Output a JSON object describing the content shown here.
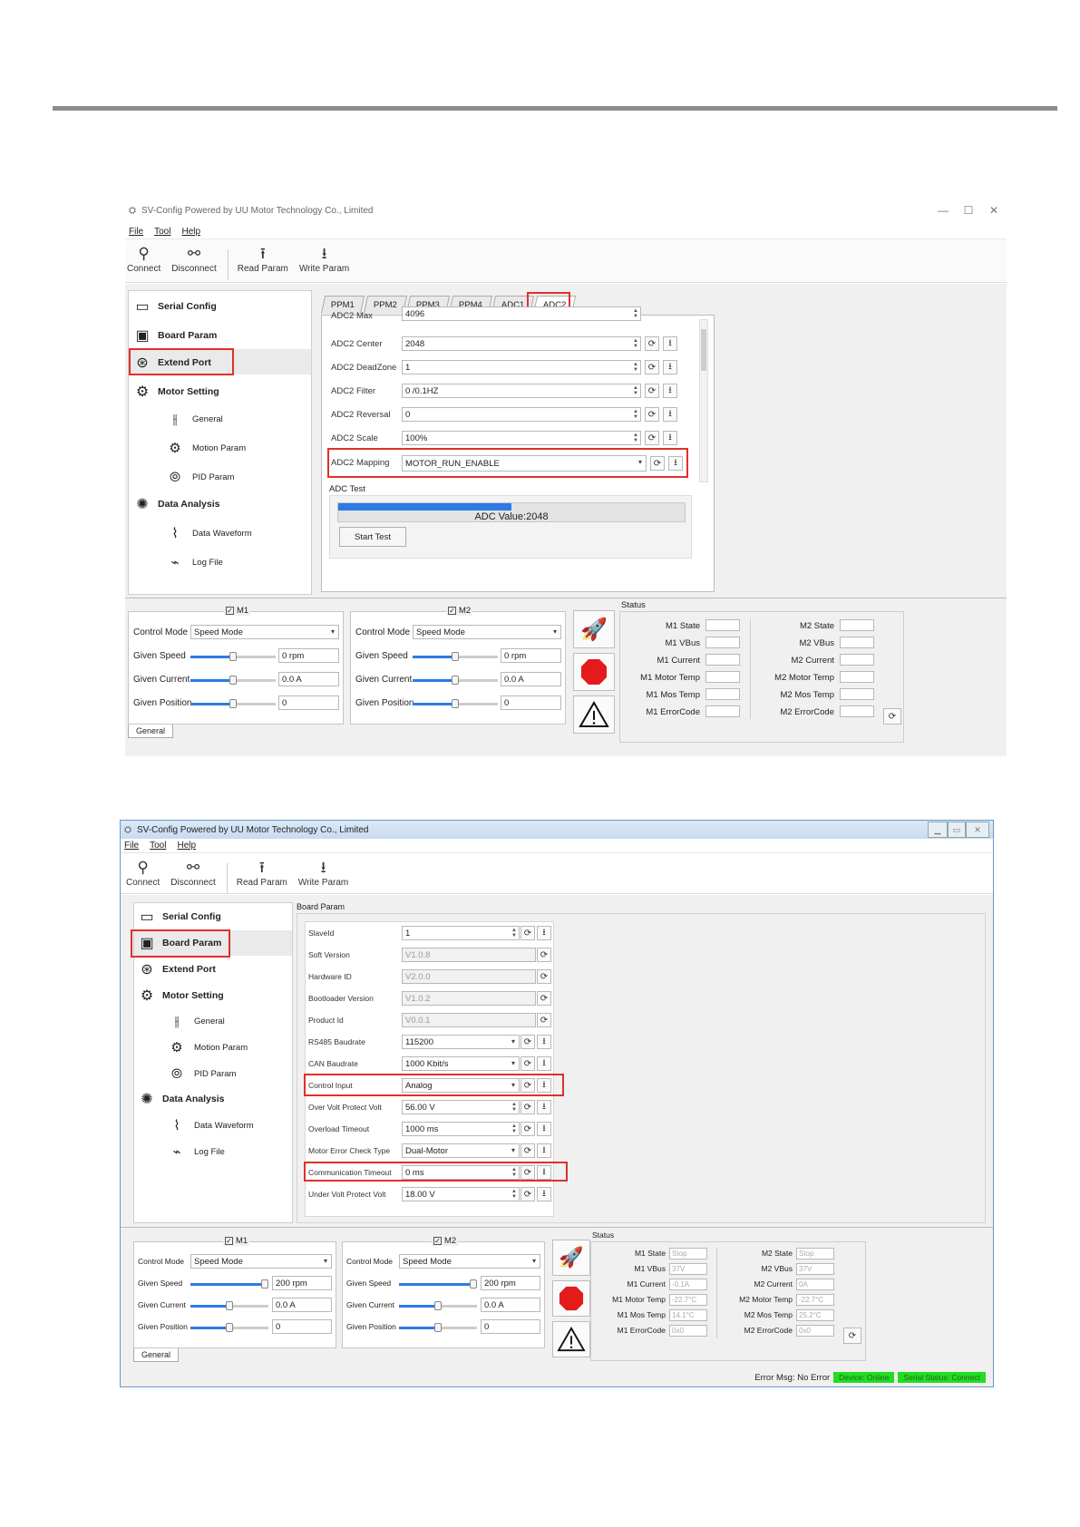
{
  "win1": {
    "title": "SV-Config Powered by UU Motor Technology Co., Limited",
    "menu": [
      "File",
      "Tool",
      "Help"
    ],
    "toolbar": [
      {
        "label": "Connect",
        "icon": "connect-icon"
      },
      {
        "label": "Disconnect",
        "icon": "disconnect-icon"
      },
      {
        "label": "Read Param",
        "icon": "upload-icon"
      },
      {
        "label": "Write Param",
        "icon": "download-icon"
      }
    ],
    "nav": {
      "serial_config": "Serial Config",
      "board_param": "Board Param",
      "extend_port": "Extend Port",
      "motor_setting": "Motor Setting",
      "general": "General",
      "motion_param": "Motion Param",
      "pid_param": "PID Param",
      "data_analysis": "Data Analysis",
      "data_waveform": "Data Waveform",
      "log_file": "Log File"
    },
    "tabs": [
      "PPM1",
      "PPM2",
      "PPM3",
      "PPM4",
      "ADC1",
      "ADC2"
    ],
    "selected_tab": "ADC2",
    "params": [
      {
        "label": "ADC2 Max",
        "value": "4096"
      },
      {
        "label": "ADC2 Center",
        "value": "2048"
      },
      {
        "label": "ADC2 DeadZone",
        "value": "1"
      },
      {
        "label": "ADC2 Filter",
        "value": "0 /0.1HZ"
      },
      {
        "label": "ADC2 Reversal",
        "value": "0"
      },
      {
        "label": "ADC2 Scale",
        "value": "100%"
      },
      {
        "label": "ADC2 Mapping",
        "value": "MOTOR_RUN_ENABLE"
      }
    ],
    "adc_test": {
      "title": "ADC Test",
      "value_text": "ADC Value:2048",
      "progress": 0.5,
      "start_label": "Start Test"
    },
    "m1": {
      "label": "M1",
      "control_mode_label": "Control Mode",
      "control_mode": "Speed Mode",
      "given_speed_label": "Given Speed",
      "given_speed": "0 rpm",
      "given_current_label": "Given Current",
      "given_current": "0.0 A",
      "given_position_label": "Given Position",
      "given_position": "0"
    },
    "m2": {
      "label": "M2",
      "control_mode_label": "Control Mode",
      "control_mode": "Speed Mode",
      "given_speed_label": "Given Speed",
      "given_speed": "0 rpm",
      "given_current_label": "Given Current",
      "given_current": "0.0 A",
      "given_position_label": "Given Position",
      "given_position": "0"
    },
    "bottom_tab": "General",
    "status": {
      "title": "Status",
      "m1_labels": [
        "M1 State",
        "M1 VBus",
        "M1 Current",
        "M1 Motor Temp",
        "M1 Mos Temp",
        "M1 ErrorCode"
      ],
      "m2_labels": [
        "M2 State",
        "M2 VBus",
        "M2 Current",
        "M2 Motor Temp",
        "M2 Mos Temp",
        "M2 ErrorCode"
      ]
    }
  },
  "win2": {
    "title": "SV-Config Powered by UU Motor Technology Co., Limited",
    "menu": [
      "File",
      "Tool",
      "Help"
    ],
    "toolbar": [
      {
        "label": "Connect",
        "icon": "connect-icon"
      },
      {
        "label": "Disconnect",
        "icon": "disconnect-icon"
      },
      {
        "label": "Read Param",
        "icon": "upload-icon"
      },
      {
        "label": "Write Param",
        "icon": "download-icon"
      }
    ],
    "nav": {
      "serial_config": "Serial Config",
      "board_param": "Board Param",
      "extend_port": "Extend Port",
      "motor_setting": "Motor Setting",
      "general": "General",
      "motion_param": "Motion Param",
      "pid_param": "PID Param",
      "data_analysis": "Data Analysis",
      "data_waveform": "Data Waveform",
      "log_file": "Log File"
    },
    "section_title": "Board Param",
    "params": [
      {
        "label": "SlaveId",
        "value": "1",
        "type": "spin"
      },
      {
        "label": "Soft Version",
        "value": "V1.0.8",
        "type": "readonly"
      },
      {
        "label": "Hardware ID",
        "value": "V2.0.0",
        "type": "readonly"
      },
      {
        "label": "Bootloader Version",
        "value": "V1.0.2",
        "type": "readonly"
      },
      {
        "label": "Product Id",
        "value": "V0.0.1",
        "type": "readonly"
      },
      {
        "label": "RS485 Baudrate",
        "value": "115200",
        "type": "select"
      },
      {
        "label": "CAN Baudrate",
        "value": "1000 Kbit/s",
        "type": "select"
      },
      {
        "label": "Control Input",
        "value": "Analog",
        "type": "select"
      },
      {
        "label": "Over Volt Protect Volt",
        "value": "56.00 V",
        "type": "spin"
      },
      {
        "label": "Overload Timeout",
        "value": "1000 ms",
        "type": "spin"
      },
      {
        "label": "Motor Error Check Type",
        "value": "Dual-Motor",
        "type": "select"
      },
      {
        "label": "Communication Timeout",
        "value": "0 ms",
        "type": "spin"
      },
      {
        "label": "Under Volt Protect Volt",
        "value": "18.00 V",
        "type": "spin"
      }
    ],
    "m1": {
      "label": "M1",
      "control_mode_label": "Control Mode",
      "control_mode": "Speed Mode",
      "given_speed_label": "Given Speed",
      "given_speed": "200 rpm",
      "given_current_label": "Given Current",
      "given_current": "0.0 A",
      "given_position_label": "Given Position",
      "given_position": "0"
    },
    "m2": {
      "label": "M2",
      "control_mode_label": "Control Mode",
      "control_mode": "Speed Mode",
      "given_speed_label": "Given Speed",
      "given_speed": "200 rpm",
      "given_current_label": "Given Current",
      "given_current": "0.0 A",
      "given_position_label": "Given Position",
      "given_position": "0"
    },
    "bottom_tab": "General",
    "status": {
      "title": "Status",
      "m1": [
        {
          "label": "M1 State",
          "value": "Stop"
        },
        {
          "label": "M1 VBus",
          "value": "37V"
        },
        {
          "label": "M1 Current",
          "value": "-0.1A"
        },
        {
          "label": "M1 Motor Temp",
          "value": "-22.7°C"
        },
        {
          "label": "M1 Mos Temp",
          "value": "14.1°C"
        },
        {
          "label": "M1 ErrorCode",
          "value": "0x0"
        }
      ],
      "m2": [
        {
          "label": "M2 State",
          "value": "Stop"
        },
        {
          "label": "M2 VBus",
          "value": "37V"
        },
        {
          "label": "M2 Current",
          "value": "0A"
        },
        {
          "label": "M2 Motor Temp",
          "value": "-22.7°C"
        },
        {
          "label": "M2 Mos Temp",
          "value": "25.2°C"
        },
        {
          "label": "M2 ErrorCode",
          "value": "0x0"
        }
      ]
    },
    "statusbar": {
      "error_msg": "Error Msg: No Error",
      "device_status": "Device: Online",
      "serial_status": "Serial Status: Connect"
    }
  },
  "colors": {
    "highlight": "#e0302a",
    "accent": "#2c7be5",
    "online": "#22dd22"
  }
}
